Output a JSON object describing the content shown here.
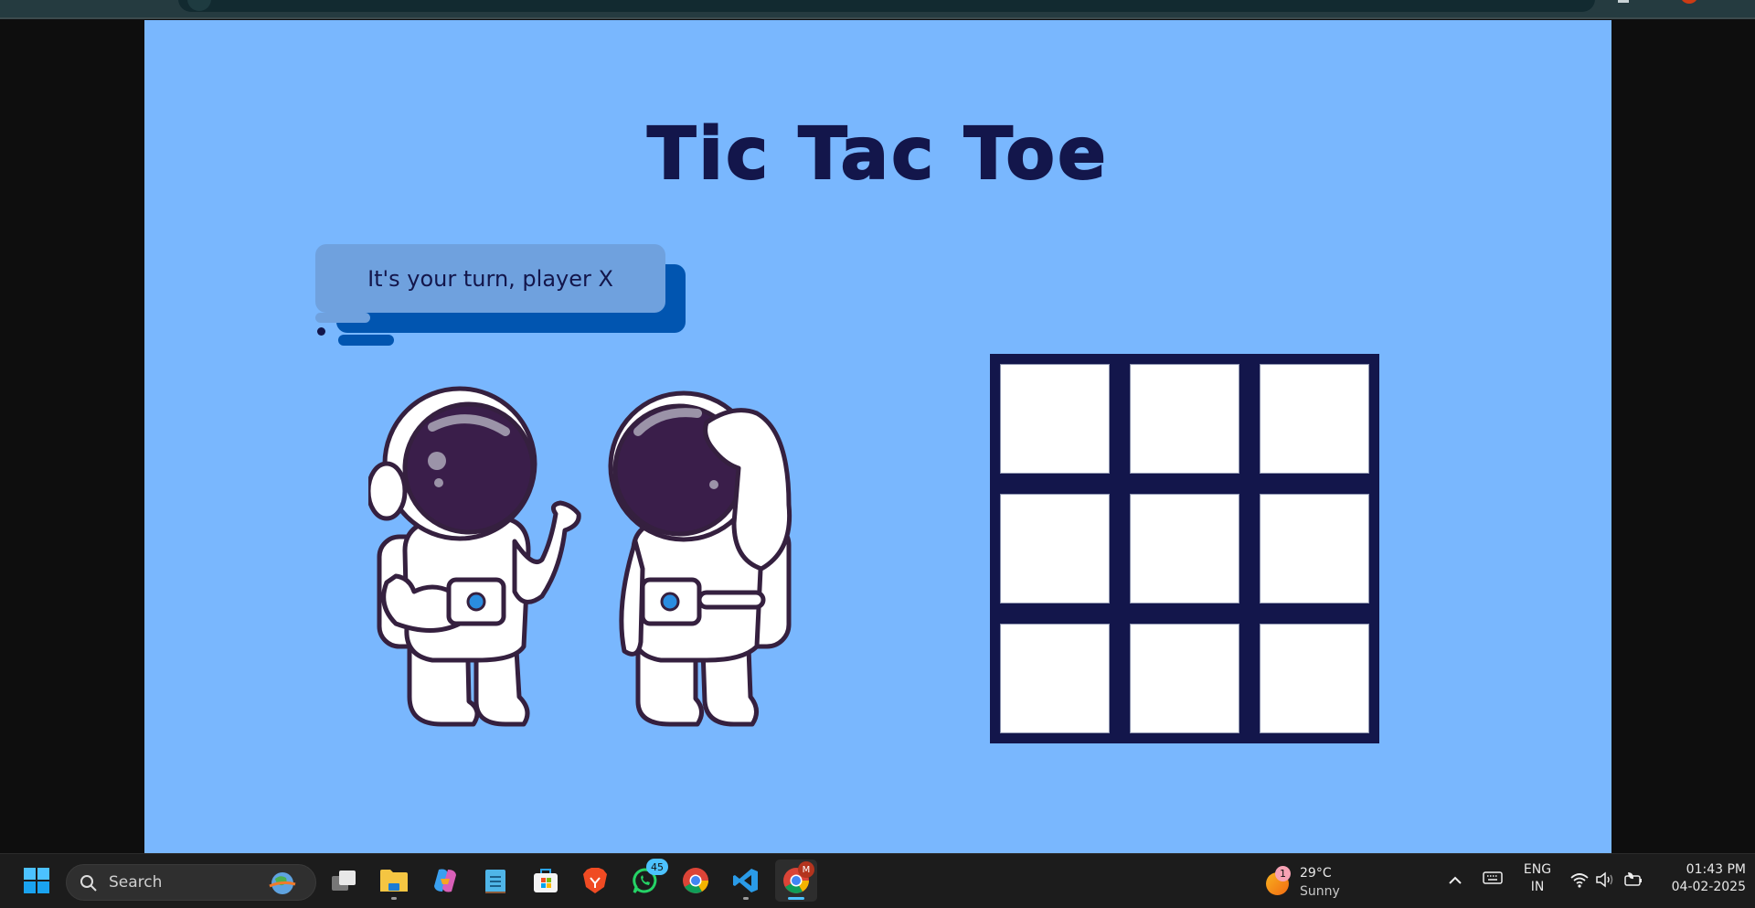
{
  "browser": {
    "url_hint": ""
  },
  "game": {
    "title": "Tic Tac Toe",
    "status_message": "It's your turn, player X",
    "current_player": "X",
    "board": [
      "",
      "",
      "",
      "",
      "",
      "",
      "",
      "",
      ""
    ],
    "colors": {
      "background": "#79b7fe",
      "primary": "#13164b",
      "bubble": "#6fa1de",
      "bubble_shadow": "#0155b0",
      "cell": "#ffffff"
    }
  },
  "taskbar": {
    "search_placeholder": "Search",
    "apps": [
      {
        "name": "task-view",
        "icon": "task-view-icon"
      },
      {
        "name": "file-explorer",
        "icon": "folder-icon",
        "running": true
      },
      {
        "name": "copilot",
        "icon": "copilot-icon"
      },
      {
        "name": "notepad",
        "icon": "notepad-icon"
      },
      {
        "name": "microsoft-store",
        "icon": "store-icon"
      },
      {
        "name": "brave",
        "icon": "brave-icon"
      },
      {
        "name": "whatsapp",
        "icon": "whatsapp-icon",
        "badge": "45"
      },
      {
        "name": "chrome",
        "icon": "chrome-icon"
      },
      {
        "name": "vscode",
        "icon": "vscode-icon",
        "running": true
      },
      {
        "name": "chrome-profile",
        "icon": "chrome-icon",
        "badge": "M",
        "active": true
      }
    ],
    "weather": {
      "badge": "1",
      "temperature": "29°C",
      "condition": "Sunny"
    },
    "language": {
      "line1": "ENG",
      "line2": "IN"
    },
    "clock": {
      "time": "01:43 PM",
      "date": "04-02-2025"
    }
  }
}
